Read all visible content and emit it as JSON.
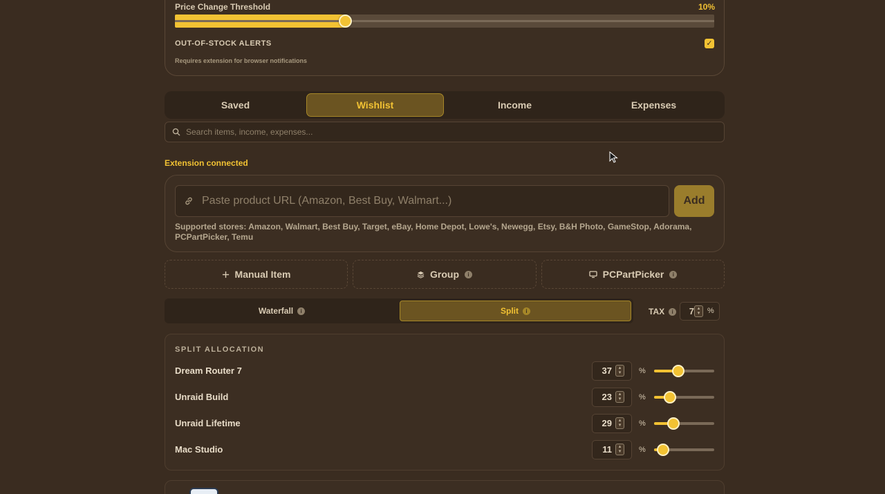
{
  "settings": {
    "price_change_label": "Price Change Threshold",
    "price_change_value": "10%",
    "price_change_fraction": 0.315,
    "oos_label": "OUT-OF-STOCK ALERTS",
    "oos_checked": true,
    "oos_note": "Requires extension for browser notifications"
  },
  "tabs": [
    "Saved",
    "Wishlist",
    "Income",
    "Expenses"
  ],
  "active_tab": "Wishlist",
  "search": {
    "placeholder": "Search items, income, expenses..."
  },
  "extension_status": "Extension connected",
  "url_input": {
    "placeholder": "Paste product URL (Amazon, Best Buy, Walmart...)",
    "add_label": "Add"
  },
  "supported_stores": "Supported stores: Amazon, Walmart, Best Buy, Target, eBay, Home Depot, Lowe's, Newegg, Etsy, B&H Photo, GameStop, Adorama, PCPartPicker, Temu",
  "actions": {
    "manual": "Manual Item",
    "group": "Group",
    "pcpartpicker": "PCPartPicker"
  },
  "mode": {
    "waterfall": "Waterfall",
    "split": "Split",
    "active": "Split"
  },
  "tax": {
    "label": "TAX",
    "value": "7",
    "unit": "%"
  },
  "split": {
    "title": "SPLIT ALLOCATION",
    "unit": "%",
    "rows": [
      {
        "name": "Dream Router 7",
        "value": "37"
      },
      {
        "name": "Unraid Build",
        "value": "23"
      },
      {
        "name": "Unraid Lifetime",
        "value": "29"
      },
      {
        "name": "Mac Studio",
        "value": "11"
      }
    ]
  },
  "icons": {
    "search": "search-icon",
    "link": "link-icon",
    "plus": "plus-icon",
    "layers": "layers-icon",
    "monitor": "monitor-icon",
    "info": "info-icon"
  },
  "colors": {
    "accent": "#f2c233",
    "background": "#3a2c20"
  }
}
